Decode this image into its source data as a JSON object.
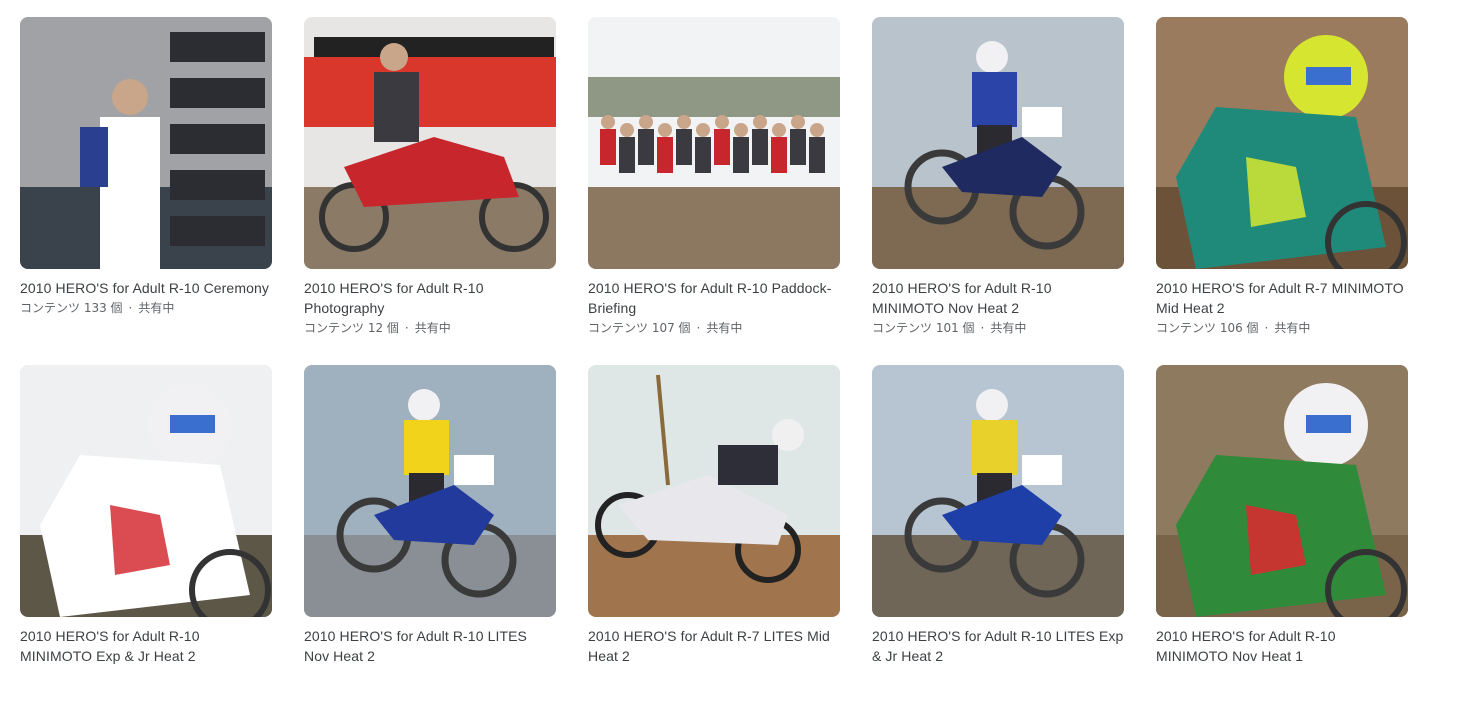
{
  "albums": [
    {
      "title": "2010 HERO'S for Adult R-10 Ceremony",
      "count": "コンテンツ 133 個",
      "shared": "共有中",
      "colors": {
        "sky": "#e8e8ea",
        "ground": "#4a5560",
        "accent": "#ffffff",
        "subject": "#2a3f8f"
      },
      "icon": "podium-photo-icon"
    },
    {
      "title": "2010 HERO'S for Adult R-10 Photography",
      "count": "コンテンツ 12 個",
      "shared": "共有中",
      "colors": {
        "sky": "#e8e6e4",
        "ground": "#8a7a66",
        "accent": "#d9372c",
        "subject": "#c8262d"
      },
      "icon": "motorbike-photo-icon"
    },
    {
      "title": "2010 HERO'S for Adult R-10 Paddock-Briefing",
      "count": "コンテンツ 107 個",
      "shared": "共有中",
      "colors": {
        "sky": "#f2f3f5",
        "ground": "#8c7760",
        "accent": "#4b5b3a",
        "subject": "#3a3a40"
      },
      "icon": "group-photo-icon"
    },
    {
      "title": "2010 HERO'S for Adult R-10 MINIMOTO Nov Heat 2",
      "count": "コンテンツ 101 個",
      "shared": "共有中",
      "colors": {
        "sky": "#b9c3cc",
        "ground": "#7e6a52",
        "accent": "#2a44a8",
        "subject": "#1f2a60"
      },
      "icon": "jump-photo-icon"
    },
    {
      "title": "2010 HERO'S for Adult R-7 MINIMOTO Mid Heat 2",
      "count": "コンテンツ 106 個",
      "shared": "共有中",
      "colors": {
        "sky": "#9b7b5d",
        "ground": "#6b5238",
        "accent": "#d6e630",
        "subject": "#1f8a7a"
      },
      "icon": "rider-closeup-photo-icon"
    },
    {
      "title": "2010 HERO'S for Adult R-10 MINIMOTO Exp & Jr Heat 2",
      "count": "",
      "shared": "",
      "colors": {
        "sky": "#eef0f2",
        "ground": "#5d5748",
        "accent": "#d52b34",
        "subject": "#ffffff"
      },
      "icon": "rider-cornering-photo-icon"
    },
    {
      "title": "2010 HERO'S for Adult R-10 LITES Nov Heat 2",
      "count": "",
      "shared": "",
      "colors": {
        "sky": "#9fb0bf",
        "ground": "#8a8f96",
        "accent": "#f2d31b",
        "subject": "#213a9c"
      },
      "icon": "jump-photo-icon"
    },
    {
      "title": "2010 HERO'S for Adult R-7 LITES Mid Heat 2",
      "count": "",
      "shared": "",
      "colors": {
        "sky": "#dfe7e6",
        "ground": "#a0744d",
        "accent": "#2e2e38",
        "subject": "#e8e8ec"
      },
      "icon": "slide-photo-icon"
    },
    {
      "title": "2010 HERO'S for Adult R-10 LITES Exp & Jr Heat 2",
      "count": "",
      "shared": "",
      "colors": {
        "sky": "#b7c4d2",
        "ground": "#6f6658",
        "accent": "#e8d12a",
        "subject": "#1f3fa8"
      },
      "icon": "jump-photo-icon"
    },
    {
      "title": "2010 HERO'S for Adult R-10 MINIMOTO Nov Heat 1",
      "count": "",
      "shared": "",
      "colors": {
        "sky": "#8e7a5f",
        "ground": "#7a6449",
        "accent": "#e0272f",
        "subject": "#2f8a3a"
      },
      "icon": "rider-cornering-photo-icon"
    }
  ]
}
